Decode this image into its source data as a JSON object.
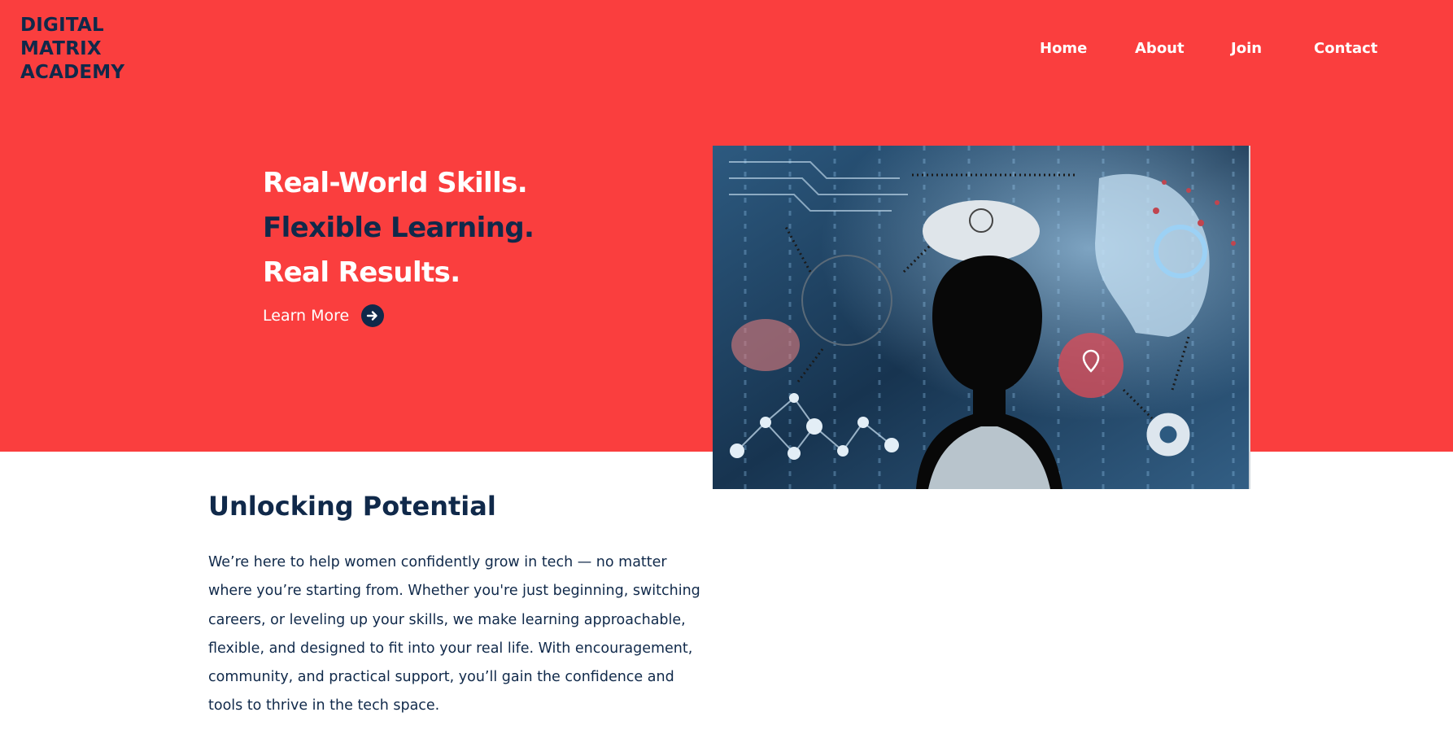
{
  "brand": {
    "line1": "DIGITAL",
    "line2": "MATRIX",
    "line3": "ACADEMY"
  },
  "nav": {
    "items": [
      {
        "label": "Home"
      },
      {
        "label": "About"
      },
      {
        "label": "Join"
      },
      {
        "label": "Contact"
      }
    ]
  },
  "hero": {
    "line1": "Real-World Skills.",
    "line2": "Flexible Learning.",
    "line3": "Real Results.",
    "cta_label": "Learn More",
    "cta_icon": "arrow-right-circle-icon",
    "image_subject": "student-silhouette-tech-collage"
  },
  "section": {
    "title": "Unlocking Potential",
    "body": "We’re here to help women confidently grow in tech — no matter where you’re starting from. Whether you're just beginning, switching careers, or leveling up your skills, we make learning approachable, flexible, and designed to fit into your real life. With encouragement, community, and practical support, you’ll gain the confidence and tools to thrive in the tech space."
  },
  "colors": {
    "brand_red": "#fa3e3e",
    "navy": "#10294a",
    "white": "#ffffff"
  }
}
